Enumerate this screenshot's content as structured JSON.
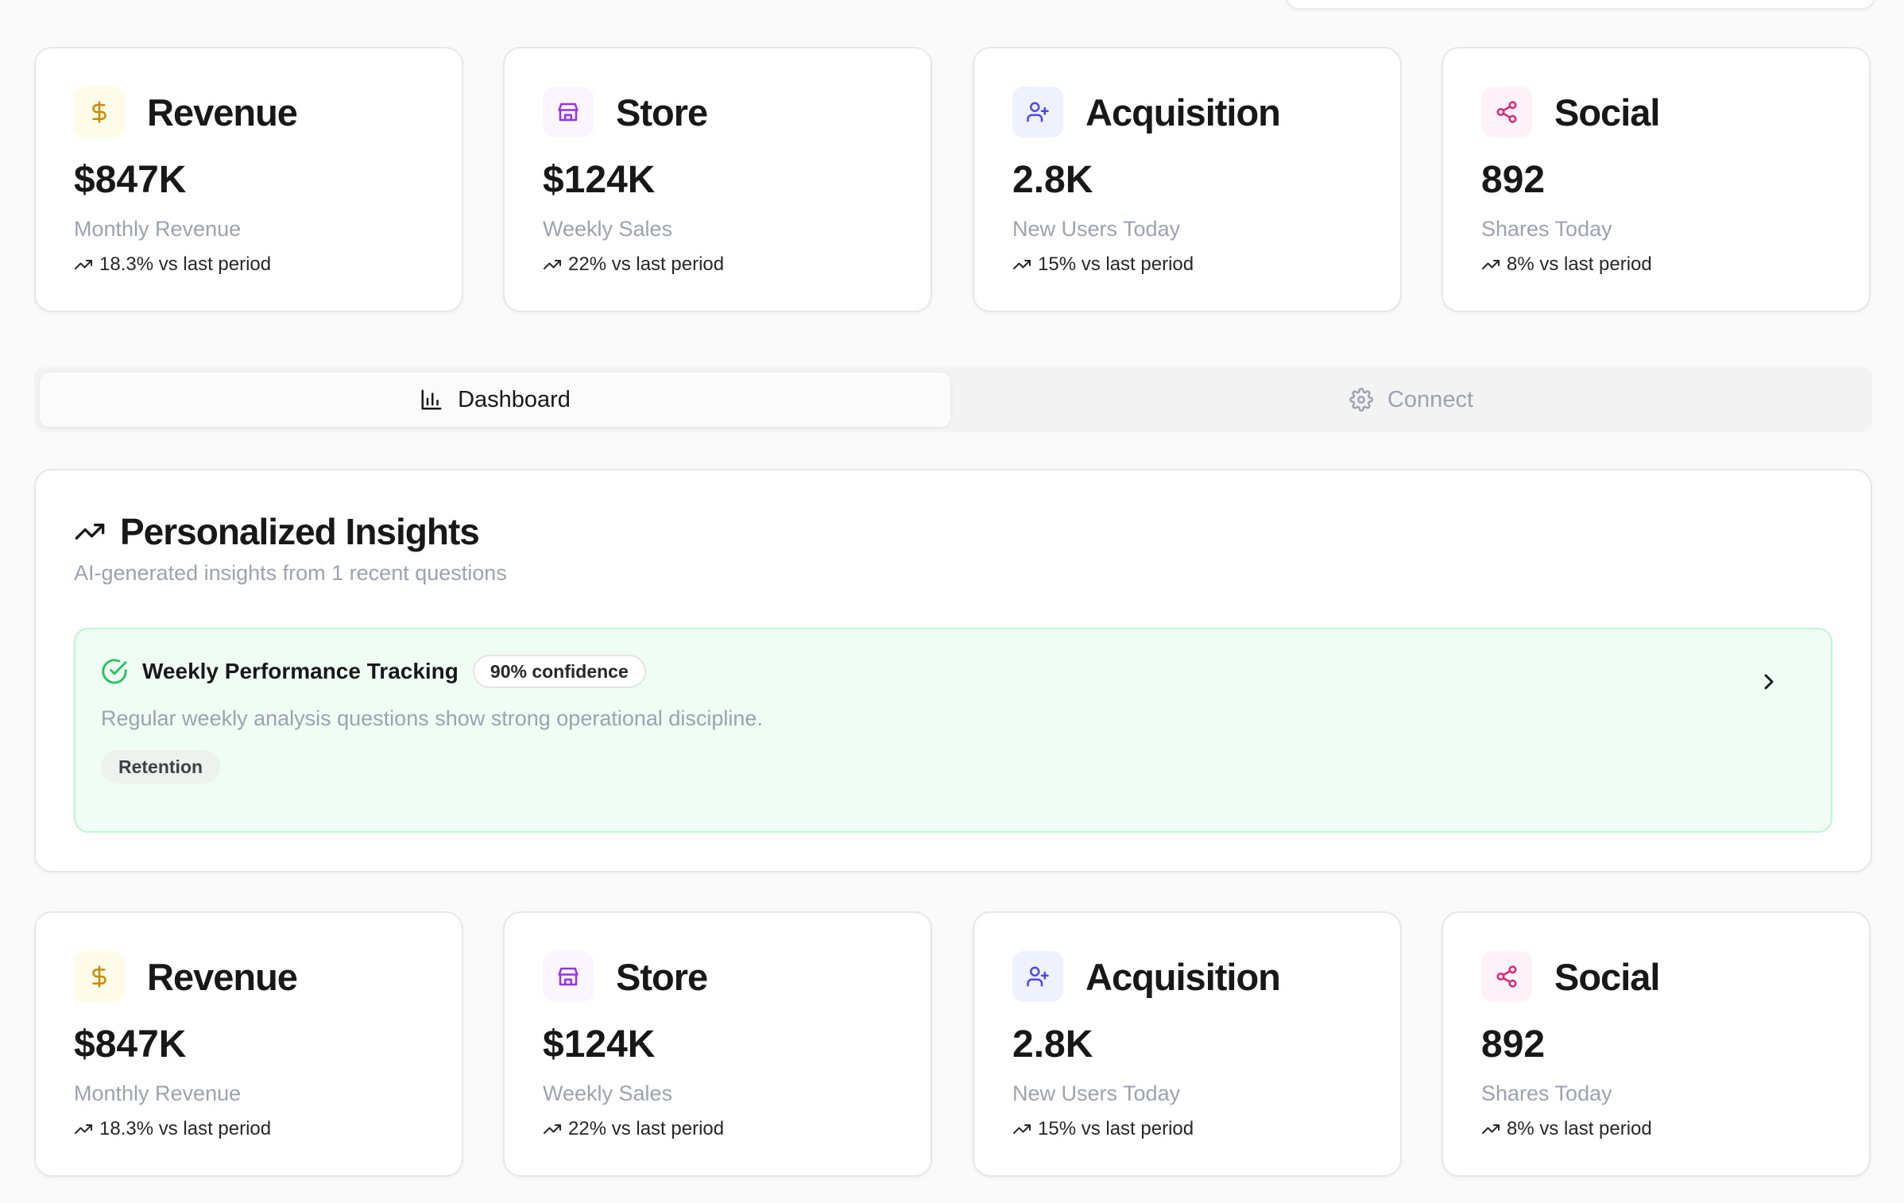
{
  "metrics_top": [
    {
      "title": "Revenue",
      "value": "$847K",
      "subtitle": "Monthly Revenue",
      "trend": "18.3% vs last period",
      "icon": "dollar-icon",
      "icon_color": "#ca8a04",
      "icon_bg": "#fefce8"
    },
    {
      "title": "Store",
      "value": "$124K",
      "subtitle": "Weekly Sales",
      "trend": "22% vs last period",
      "icon": "store-icon",
      "icon_color": "#9333ea",
      "icon_bg": "#faf5ff"
    },
    {
      "title": "Acquisition",
      "value": "2.8K",
      "subtitle": "New Users Today",
      "trend": "15% vs last period",
      "icon": "user-plus-icon",
      "icon_color": "#4f46e5",
      "icon_bg": "#eef2ff"
    },
    {
      "title": "Social",
      "value": "892",
      "subtitle": "Shares Today",
      "trend": "8% vs last period",
      "icon": "share-icon",
      "icon_color": "#db2777",
      "icon_bg": "#fdf2f8"
    }
  ],
  "tabs": [
    {
      "label": "Dashboard",
      "icon": "bar-chart-icon",
      "active": true
    },
    {
      "label": "Connect",
      "icon": "gear-icon",
      "active": false
    }
  ],
  "insights": {
    "title": "Personalized Insights",
    "subtitle": "AI-generated insights from 1 recent questions",
    "items": [
      {
        "title": "Weekly Performance Tracking",
        "confidence": "90% confidence",
        "description": "Regular weekly analysis questions show strong operational discipline.",
        "tag": "Retention",
        "status_color": "#22c55e"
      }
    ]
  },
  "metrics_bottom": [
    {
      "title": "Revenue",
      "value": "$847K",
      "subtitle": "Monthly Revenue",
      "trend": "18.3% vs last period"
    },
    {
      "title": "Store",
      "value": "$124K",
      "subtitle": "Weekly Sales",
      "trend": "22% vs last period"
    },
    {
      "title": "Acquisition",
      "value": "2.8K",
      "subtitle": "New Users Today",
      "trend": "15% vs last period"
    },
    {
      "title": "Social",
      "value": "892",
      "subtitle": "Shares Today",
      "trend": "8% vs last period"
    }
  ]
}
